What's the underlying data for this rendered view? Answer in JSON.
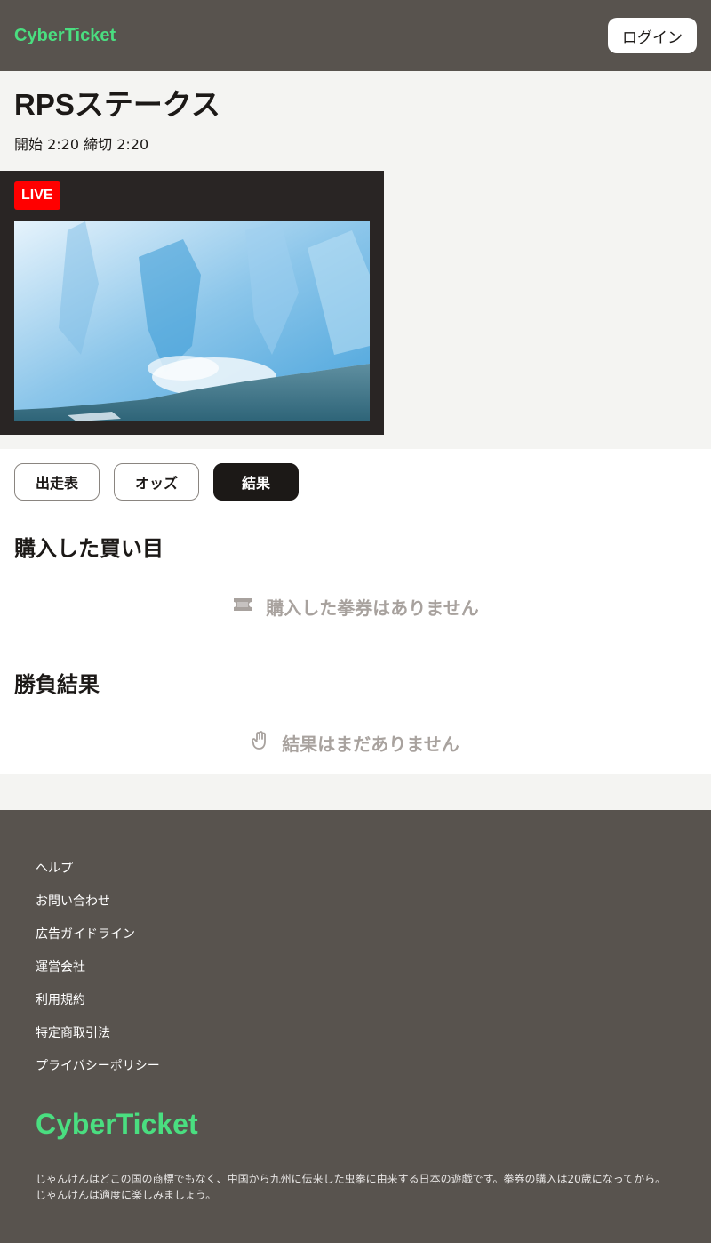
{
  "header": {
    "logo": "CyberTicket",
    "login_label": "ログイン"
  },
  "race": {
    "title": "RPSステークス",
    "times": "開始 2:20 締切 2:20"
  },
  "live": {
    "badge": "LIVE"
  },
  "tabs": [
    {
      "label": "出走表",
      "active": false
    },
    {
      "label": "オッズ",
      "active": false
    },
    {
      "label": "結果",
      "active": true
    }
  ],
  "purchased": {
    "title": "購入した買い目",
    "empty_text": "購入した拳券はありません",
    "icon": "ticket-icon"
  },
  "results": {
    "title": "勝負結果",
    "empty_text": "結果はまだありません",
    "icon": "hand-icon"
  },
  "footer": {
    "links": [
      "ヘルプ",
      "お問い合わせ",
      "広告ガイドライン",
      "運営会社",
      "利用規約",
      "特定商取引法",
      "プライバシーポリシー"
    ],
    "logo": "CyberTicket",
    "note": "じゃんけんはどこの国の商標でもなく、中国から九州に伝来した虫拳に由来する日本の遊戯です。拳券の購入は20歳になってから。じゃんけんは適度に楽しみましょう。"
  },
  "colors": {
    "header_bg": "#58534e",
    "brand": "#4ade80",
    "live": "#ff0000",
    "active_tab": "#1c1917"
  }
}
